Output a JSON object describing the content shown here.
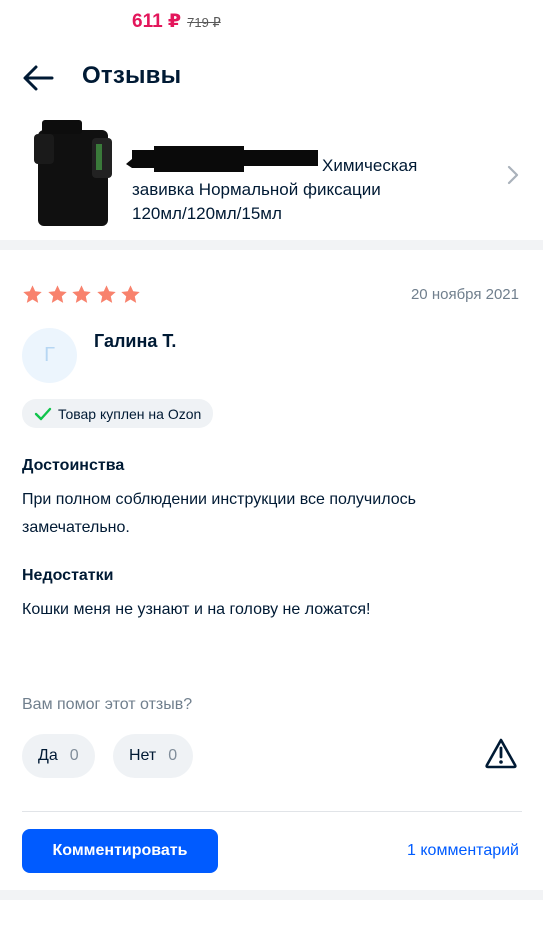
{
  "header": {
    "back_icon": "arrow-left-icon",
    "title": "Отзывы"
  },
  "product": {
    "price_current": "611 ₽",
    "price_old": "719 ₽",
    "title_visible": "Химическая завивка Нормальной фиксации 120мл/120мл/15мл",
    "chevron_icon": "chevron-right-icon"
  },
  "review": {
    "rating": 5,
    "rating_max": 5,
    "star_color": "#f8826d",
    "date": "20 ноября 2021",
    "avatar_initial": "Г",
    "author": "Галина Т.",
    "badge": {
      "icon": "check-icon",
      "text": "Товар куплен на Ozon"
    },
    "pros_title": "Достоинства",
    "pros_text": "При полном соблюдении инструкции все получилось замечательно.",
    "cons_title": "Недостатки",
    "cons_text": "Кошки меня не узнают и на голову не ложатся!"
  },
  "helpful": {
    "question": "Вам помог этот отзыв?",
    "yes_label": "Да",
    "yes_count": "0",
    "no_label": "Нет",
    "no_count": "0",
    "report_icon": "warning-icon"
  },
  "actions": {
    "comment_button": "Комментировать",
    "comments_link": "1 комментарий"
  },
  "colors": {
    "accent": "#005bff",
    "price": "#e3165b",
    "check": "#10c44c"
  }
}
